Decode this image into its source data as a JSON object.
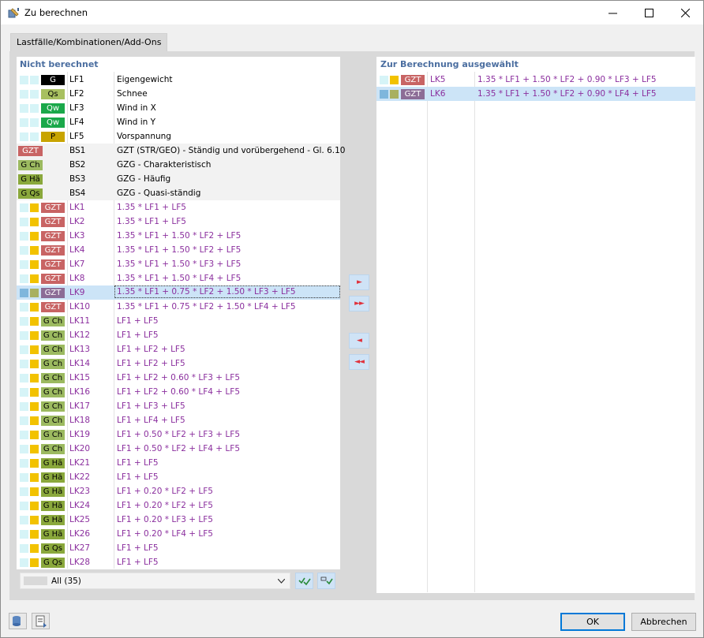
{
  "window": {
    "title": "Zu berechnen",
    "minimize": "—",
    "maximize": "☐",
    "close": "✕"
  },
  "tabs": [
    {
      "label": "Lastfälle/Kombinationen/Add-Ons"
    }
  ],
  "left": {
    "title": "Nicht berechnet",
    "rows": [
      {
        "badge": "G",
        "code": "LF1",
        "desc": "Eigengewicht",
        "type": "lf"
      },
      {
        "badge": "Qs",
        "code": "LF2",
        "desc": "Schnee",
        "type": "lf"
      },
      {
        "badge": "Qw",
        "code": "LF3",
        "desc": "Wind in X",
        "type": "lf"
      },
      {
        "badge": "Qw",
        "code": "LF4",
        "desc": "Wind in Y",
        "type": "lf"
      },
      {
        "badge": "P",
        "code": "LF5",
        "desc": "Vorspannung",
        "type": "lf"
      },
      {
        "badge": "GZT",
        "code": "BS1",
        "desc": "GZT (STR/GEO) - Ständig und vorübergehend - Gl. 6.10",
        "type": "bs"
      },
      {
        "badge": "G Ch",
        "code": "BS2",
        "desc": "GZG - Charakteristisch",
        "type": "bs"
      },
      {
        "badge": "G Hä",
        "code": "BS3",
        "desc": "GZG - Häufig",
        "type": "bs"
      },
      {
        "badge": "G Qs",
        "code": "BS4",
        "desc": "GZG - Quasi-ständig",
        "type": "bs"
      },
      {
        "badge": "GZT",
        "code": "LK1",
        "desc": "1.35 * LF1 + LF5",
        "type": "lk"
      },
      {
        "badge": "GZT",
        "code": "LK2",
        "desc": "1.35 * LF1 + LF5",
        "type": "lk"
      },
      {
        "badge": "GZT",
        "code": "LK3",
        "desc": "1.35 * LF1 + 1.50 * LF2 + LF5",
        "type": "lk"
      },
      {
        "badge": "GZT",
        "code": "LK4",
        "desc": "1.35 * LF1 + 1.50 * LF2 + LF5",
        "type": "lk"
      },
      {
        "badge": "GZT",
        "code": "LK7",
        "desc": "1.35 * LF1 + 1.50 * LF3 + LF5",
        "type": "lk"
      },
      {
        "badge": "GZT",
        "code": "LK8",
        "desc": "1.35 * LF1 + 1.50 * LF4 + LF5",
        "type": "lk"
      },
      {
        "badge": "GZT",
        "code": "LK9",
        "desc": "1.35 * LF1 + 0.75 * LF2 + 1.50 * LF3 + LF5",
        "type": "lk",
        "selected": true
      },
      {
        "badge": "GZT",
        "code": "LK10",
        "desc": "1.35 * LF1 + 0.75 * LF2 + 1.50 * LF4 + LF5",
        "type": "lk"
      },
      {
        "badge": "G Ch",
        "code": "LK11",
        "desc": "LF1 + LF5",
        "type": "lk"
      },
      {
        "badge": "G Ch",
        "code": "LK12",
        "desc": "LF1 + LF5",
        "type": "lk"
      },
      {
        "badge": "G Ch",
        "code": "LK13",
        "desc": "LF1 + LF2 + LF5",
        "type": "lk"
      },
      {
        "badge": "G Ch",
        "code": "LK14",
        "desc": "LF1 + LF2 + LF5",
        "type": "lk"
      },
      {
        "badge": "G Ch",
        "code": "LK15",
        "desc": "LF1 + LF2 + 0.60 * LF3 + LF5",
        "type": "lk"
      },
      {
        "badge": "G Ch",
        "code": "LK16",
        "desc": "LF1 + LF2 + 0.60 * LF4 + LF5",
        "type": "lk"
      },
      {
        "badge": "G Ch",
        "code": "LK17",
        "desc": "LF1 + LF3 + LF5",
        "type": "lk"
      },
      {
        "badge": "G Ch",
        "code": "LK18",
        "desc": "LF1 + LF4 + LF5",
        "type": "lk"
      },
      {
        "badge": "G Ch",
        "code": "LK19",
        "desc": "LF1 + 0.50 * LF2 + LF3 + LF5",
        "type": "lk"
      },
      {
        "badge": "G Ch",
        "code": "LK20",
        "desc": "LF1 + 0.50 * LF2 + LF4 + LF5",
        "type": "lk"
      },
      {
        "badge": "G Hä",
        "code": "LK21",
        "desc": "LF1 + LF5",
        "type": "lk"
      },
      {
        "badge": "G Hä",
        "code": "LK22",
        "desc": "LF1 + LF5",
        "type": "lk"
      },
      {
        "badge": "G Hä",
        "code": "LK23",
        "desc": "LF1 + 0.20 * LF2 + LF5",
        "type": "lk"
      },
      {
        "badge": "G Hä",
        "code": "LK24",
        "desc": "LF1 + 0.20 * LF2 + LF5",
        "type": "lk"
      },
      {
        "badge": "G Hä",
        "code": "LK25",
        "desc": "LF1 + 0.20 * LF3 + LF5",
        "type": "lk"
      },
      {
        "badge": "G Hä",
        "code": "LK26",
        "desc": "LF1 + 0.20 * LF4 + LF5",
        "type": "lk"
      },
      {
        "badge": "G Qs",
        "code": "LK27",
        "desc": "LF1 + LF5",
        "type": "lk"
      },
      {
        "badge": "G Qs",
        "code": "LK28",
        "desc": "LF1 + LF5",
        "type": "lk"
      }
    ],
    "filter": {
      "value": "All (35)"
    }
  },
  "right": {
    "title": "Zur Berechnung ausgewählt",
    "rows": [
      {
        "badge": "GZT",
        "code": "LK5",
        "desc": "1.35 * LF1 + 1.50 * LF2 + 0.90 * LF3 + LF5",
        "type": "lk"
      },
      {
        "badge": "GZT",
        "code": "LK6",
        "desc": "1.35 * LF1 + 1.50 * LF2 + 0.90 * LF4 + LF5",
        "type": "lk",
        "selected": true
      }
    ]
  },
  "transfer": {
    "add_one": "►",
    "add_all": "►►",
    "remove_one": "◄",
    "remove_all": "◄◄"
  },
  "footer": {
    "ok": "OK",
    "cancel": "Abbrechen"
  },
  "colors": {
    "G": "#000000",
    "Qs": "#a8c060",
    "Qw": "#1aa84a",
    "P": "#c8a400",
    "GZT": "#c86464",
    "G Ch": "#9cba60",
    "G Hä": "#8aa83c",
    "G Qs": "#8aa83c",
    "selection": "#cce4f7",
    "purple": "#8b2f9e",
    "accent": "#4b6ea0"
  }
}
